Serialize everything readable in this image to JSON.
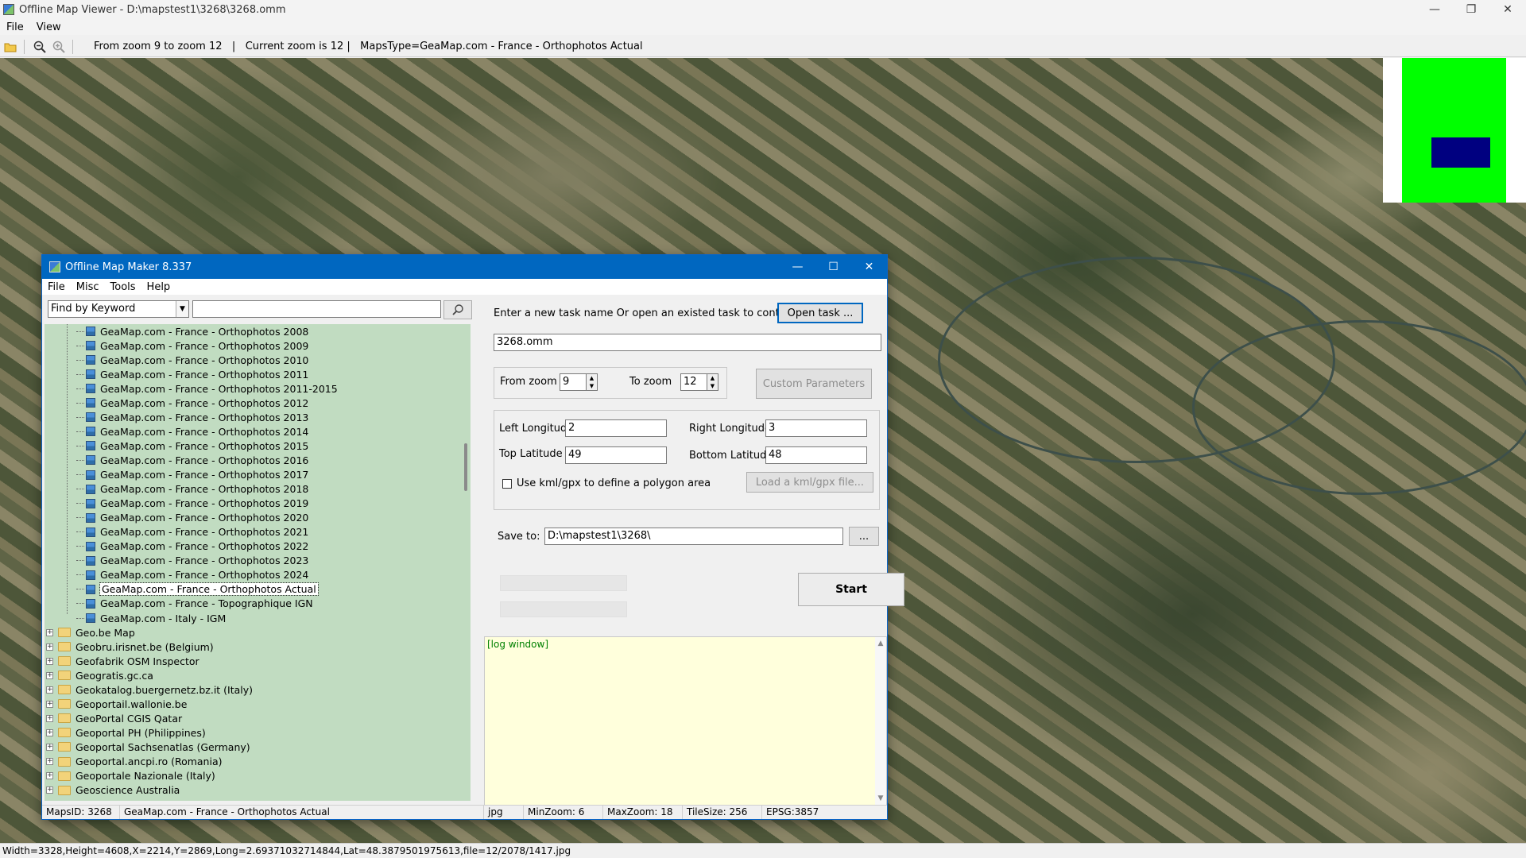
{
  "window": {
    "title": "Offline Map Viewer - D:\\mapstest1\\3268\\3268.omm"
  },
  "menu": [
    "File",
    "View"
  ],
  "toolbar": {
    "info": "From zoom 9 to zoom 12   |   Current zoom is 12 |   MapsType=GeaMap.com - France - Orthophotos Actual"
  },
  "status": "Width=3328,Height=4608,X=2214,Y=2869,Long=2.69371032714844,Lat=48.3879501975613,file=12/2078/1417.jpg",
  "colors": {
    "accent": "#0067c0",
    "tree_bg": "#c1dcc1",
    "minimap_area": "#00ff00",
    "minimap_view": "#000080",
    "log_bg": "#ffffdc"
  },
  "dialog": {
    "title": "Offline Map Maker 8.337",
    "menu": [
      "File",
      "Misc",
      "Tools",
      "Help"
    ],
    "search": {
      "mode": "Find by Keyword",
      "keyword": ""
    },
    "tree_children": [
      "GeaMap.com - France - Orthophotos 2008",
      "GeaMap.com - France - Orthophotos 2009",
      "GeaMap.com - France - Orthophotos 2010",
      "GeaMap.com - France - Orthophotos 2011",
      "GeaMap.com - France - Orthophotos 2011-2015",
      "GeaMap.com - France - Orthophotos 2012",
      "GeaMap.com - France - Orthophotos 2013",
      "GeaMap.com - France - Orthophotos 2014",
      "GeaMap.com - France - Orthophotos 2015",
      "GeaMap.com - France - Orthophotos 2016",
      "GeaMap.com - France - Orthophotos 2017",
      "GeaMap.com - France - Orthophotos 2018",
      "GeaMap.com - France - Orthophotos 2019",
      "GeaMap.com - France - Orthophotos 2020",
      "GeaMap.com - France - Orthophotos 2021",
      "GeaMap.com - France - Orthophotos 2022",
      "GeaMap.com - France - Orthophotos 2023",
      "GeaMap.com - France - Orthophotos 2024",
      "GeaMap.com - France - Orthophotos Actual",
      "GeaMap.com - France - Topographique IGN",
      "GeaMap.com - Italy - IGM"
    ],
    "selected_index": 18,
    "tree_folders": [
      "Geo.be Map",
      "Geobru.irisnet.be (Belgium)",
      "Geofabrik OSM Inspector",
      "Geogratis.gc.ca",
      "Geokatalog.buergernetz.bz.it (Italy)",
      "Geoportail.wallonie.be",
      "GeoPortal CGIS Qatar",
      "Geoportal PH (Philippines)",
      "Geoportal Sachsenatlas (Germany)",
      "Geoportal.ancpi.ro (Romania)",
      "Geoportale Nazionale (Italy)",
      "Geoscience Australia"
    ],
    "task": {
      "prompt": "Enter a new task name Or open an existed task to continue:",
      "open_label": "Open task ...",
      "name": "3268.omm"
    },
    "zoom": {
      "from_label": "From zoom",
      "from": "9",
      "to_label": "To zoom",
      "to": "12",
      "custom_label": "Custom Parameters"
    },
    "bounds": {
      "left_label": "Left Longitude",
      "left": "2",
      "right_label": "Right Longitude",
      "right": "3",
      "top_label": "Top Latitude",
      "top": "49",
      "bottom_label": "Bottom Latitude",
      "bottom": "48",
      "kml_label": "Use kml/gpx to define a polygon area",
      "kml_checked": false,
      "load_label": "Load a kml/gpx file..."
    },
    "save": {
      "label": "Save to:",
      "path": "D:\\mapstest1\\3268\\",
      "browse": "..."
    },
    "start_label": "Start",
    "log": "[log window]",
    "statusbar": {
      "maps_id": "MapsID: 3268",
      "map_name": "GeaMap.com - France - Orthophotos Actual",
      "format": "jpg",
      "min_zoom": "MinZoom: 6",
      "max_zoom": "MaxZoom: 18",
      "tile_size": "TileSize: 256",
      "epsg": "EPSG:3857"
    }
  }
}
